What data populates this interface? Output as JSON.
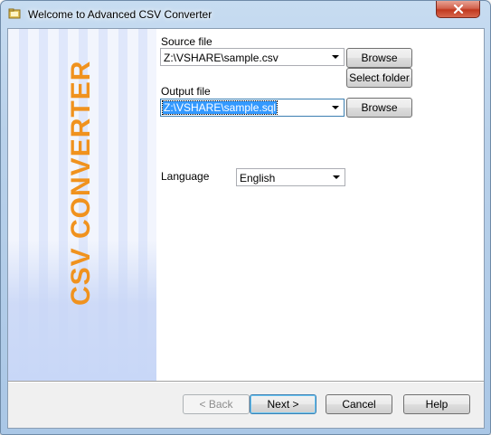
{
  "window": {
    "title": "Welcome to Advanced CSV Converter",
    "close_symbol": "×"
  },
  "banner": {
    "text": "CSV CONVERTER",
    "color": "#f0921e"
  },
  "form": {
    "source_label": "Source file",
    "source_value": "Z:\\VSHARE\\sample.csv",
    "browse_source_label": "Browse",
    "select_folder_label": "Select folder",
    "output_label": "Output file",
    "output_value": "Z:\\VSHARE\\sample.sql",
    "browse_output_label": "Browse",
    "language_label": "Language",
    "language_value": "English"
  },
  "footer": {
    "back_label": "< Back",
    "next_label": "Next >",
    "cancel_label": "Cancel",
    "help_label": "Help"
  },
  "icons": {
    "app": "app-folder-icon",
    "close": "close-icon",
    "dropdown": "chevron-down-icon"
  }
}
